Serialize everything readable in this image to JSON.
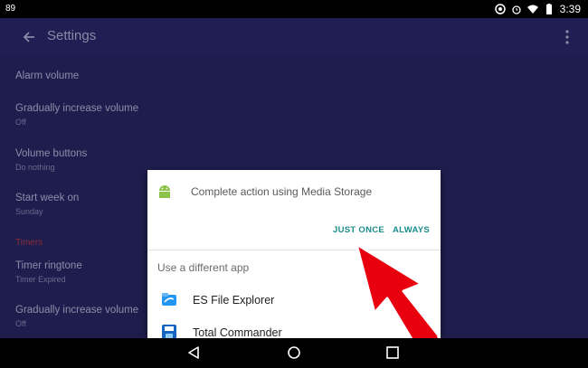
{
  "status_bar": {
    "left_indicator": "89",
    "time": "3:39"
  },
  "appbar": {
    "title": "Settings"
  },
  "settings": {
    "items": [
      {
        "title": "Alarm volume",
        "subtitle": ""
      },
      {
        "title": "Gradually increase volume",
        "subtitle": "Off"
      },
      {
        "title": "Volume buttons",
        "subtitle": "Do nothing"
      },
      {
        "title": "Start week on",
        "subtitle": "Sunday"
      }
    ],
    "section_timers": "Timers",
    "timer_items": [
      {
        "title": "Timer ringtone",
        "subtitle": "Timer Expired"
      },
      {
        "title": "Gradually increase volume",
        "subtitle": "Off"
      }
    ]
  },
  "dialog": {
    "title": "Complete action using Media Storage",
    "just_once": "JUST ONCE",
    "always": "ALWAYS",
    "use_different": "Use a different app",
    "apps": [
      {
        "name": "ES File Explorer",
        "icon": "es-file-explorer-icon"
      },
      {
        "name": "Total Commander",
        "icon": "total-commander-icon"
      }
    ]
  },
  "colors": {
    "accent": "#1a8c8c",
    "annotation_arrow": "#e8000f",
    "settings_bg": "#1f1d4d"
  }
}
